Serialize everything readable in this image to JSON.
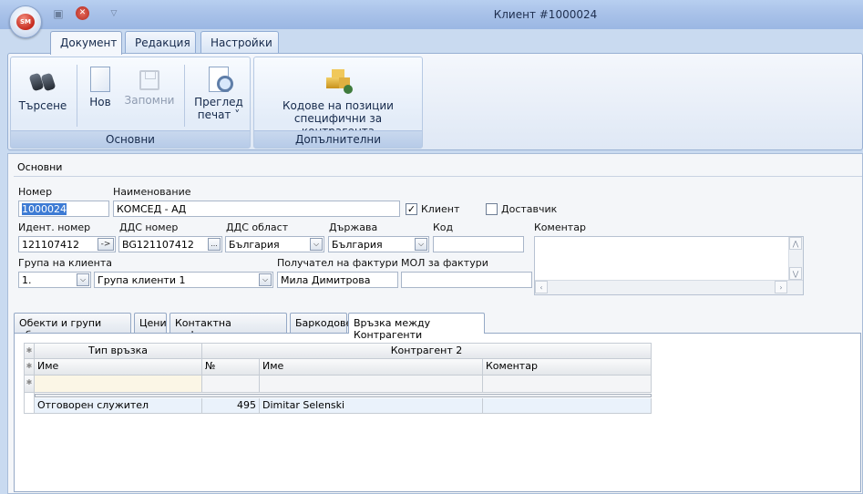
{
  "window": {
    "title": "Клиент #1000024",
    "app_logo": "SM"
  },
  "quick_access": {
    "save_icon": "save-icon",
    "close_icon": "close-icon",
    "dropdown_icon": "chevron-down-icon"
  },
  "ribbon": {
    "tabs": [
      {
        "label": "Документ",
        "active": true
      },
      {
        "label": "Редакция"
      },
      {
        "label": "Настройки"
      }
    ],
    "groups": {
      "basic": {
        "label": "Основни",
        "search": "Търсене",
        "new": "Нов",
        "save": "Запомни",
        "preview_line1": "Преглед",
        "preview_line2": "печат ˅"
      },
      "extra": {
        "label": "Допълнителни",
        "codes_line1": "Кодове на позиции",
        "codes_line2": "специфични за контрагента"
      }
    }
  },
  "form": {
    "section_title": "Основни",
    "number": {
      "label": "Номер",
      "value": "1000024"
    },
    "name": {
      "label": "Наименование",
      "value": "КОМСЕД - АД"
    },
    "client": {
      "label": "Клиент",
      "checked": true,
      "mark": "✓"
    },
    "supplier": {
      "label": "Доставчик",
      "checked": false
    },
    "ident": {
      "label": "Идент. номер",
      "value": "121107412",
      "btn": "->"
    },
    "vat": {
      "label": "ДДС номер",
      "value": "BG121107412",
      "btn": "..."
    },
    "vat_region": {
      "label": "ДДС област",
      "value": "България"
    },
    "country": {
      "label": "Държава",
      "value": "България"
    },
    "code": {
      "label": "Код",
      "value": ""
    },
    "comment": {
      "label": "Коментар",
      "value": ""
    },
    "client_group": {
      "label": "Група на клиента",
      "code": "1.",
      "name": "Група клиенти 1"
    },
    "invoice_recipient": {
      "label": "Получател на фактури",
      "value": "Мила Димитрова"
    },
    "mol": {
      "label": "МОЛ за фактури",
      "value": ""
    }
  },
  "tabs": [
    {
      "label": "Обекти и групи обекти"
    },
    {
      "label": "Цени"
    },
    {
      "label": "Контактна информация"
    },
    {
      "label": "Баркодове"
    },
    {
      "label": "Връзка между Контрагенти",
      "active": true
    }
  ],
  "grid": {
    "band_headers": {
      "relation_type": "Тип връзка",
      "counterparty2": "Контрагент 2"
    },
    "columns": {
      "name": "Име",
      "number": "№",
      "name2": "Име",
      "comment": "Коментар"
    },
    "rows": [
      {
        "name": "Отговорен служител",
        "number": "495",
        "name2": "Dimitar Selenski",
        "comment": ""
      }
    ]
  }
}
